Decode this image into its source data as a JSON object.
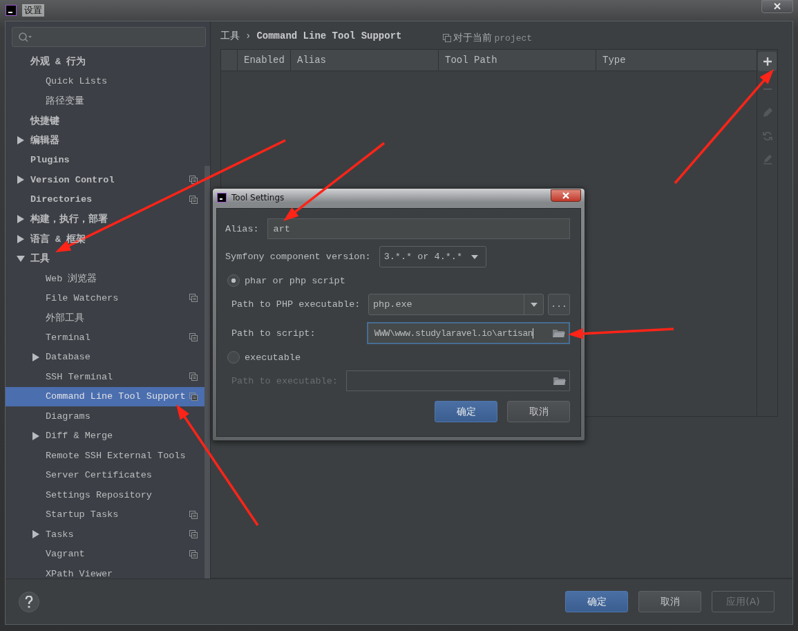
{
  "window": {
    "title": "设置"
  },
  "sidebar": {
    "items": [
      {
        "label": "外观 & 行为",
        "project": false,
        "selected": false,
        "children": [
          {
            "label": "Quick Lists",
            "project": false,
            "selected": false
          },
          {
            "label": "路径变量",
            "project": false,
            "selected": false
          }
        ]
      },
      {
        "label": "快捷键",
        "project": false,
        "selected": false
      },
      {
        "label": "编辑器",
        "expanded": false,
        "project": false,
        "selected": false
      },
      {
        "label": "Plugins",
        "project": false,
        "selected": false
      },
      {
        "label": "Version Control",
        "expanded": false,
        "project": true,
        "selected": false
      },
      {
        "label": "Directories",
        "project": true,
        "selected": false
      },
      {
        "label": "构建，执行，部署",
        "expanded": false,
        "project": false,
        "selected": false
      },
      {
        "label": "语言 & 框架",
        "expanded": false,
        "project": false,
        "selected": false
      },
      {
        "label": "工具",
        "expanded": true,
        "project": false,
        "selected": false,
        "children": [
          {
            "label": "Web 浏览器",
            "project": false,
            "selected": false
          },
          {
            "label": "File Watchers",
            "project": true,
            "selected": false
          },
          {
            "label": "外部工具",
            "project": false,
            "selected": false
          },
          {
            "label": "Terminal",
            "project": true,
            "selected": false
          },
          {
            "label": "Database",
            "expanded": false,
            "project": false,
            "selected": false
          },
          {
            "label": "SSH Terminal",
            "project": true,
            "selected": false
          },
          {
            "label": "Command Line Tool Support",
            "project": true,
            "selected": true
          },
          {
            "label": "Diagrams",
            "project": false,
            "selected": false
          },
          {
            "label": "Diff & Merge",
            "expanded": false,
            "project": false,
            "selected": false
          },
          {
            "label": "Remote SSH External Tools",
            "project": false,
            "selected": false
          },
          {
            "label": "Server Certificates",
            "project": false,
            "selected": false
          },
          {
            "label": "Settings Repository",
            "project": false,
            "selected": false
          },
          {
            "label": "Startup Tasks",
            "project": true,
            "selected": false
          },
          {
            "label": "Tasks",
            "expanded": false,
            "project": true,
            "selected": false
          },
          {
            "label": "Vagrant",
            "project": true,
            "selected": false
          },
          {
            "label": "XPath Viewer",
            "project": false,
            "selected": false
          }
        ]
      }
    ]
  },
  "breadcrumb": {
    "section": "工具",
    "separator": "›",
    "page": "Command Line Tool Support"
  },
  "scope": {
    "label": "对于当前",
    "suffix": "project"
  },
  "table": {
    "columns": [
      "Enabled",
      "Alias",
      "Tool Path",
      "Type"
    ]
  },
  "toolbar": [
    {
      "kind": "add",
      "disabled": false
    },
    {
      "kind": "remove",
      "disabled": true
    },
    {
      "kind": "edit",
      "disabled": true
    },
    {
      "kind": "reload",
      "disabled": true
    },
    {
      "kind": "rename",
      "disabled": true
    }
  ],
  "dialog": {
    "title": "Tool Settings",
    "alias": {
      "label": "Alias:",
      "value": "art"
    },
    "version": {
      "label": "Symfony component version:",
      "value": "3.*.* or 4.*.*"
    },
    "options": [
      {
        "label": "phar or php script",
        "selected": true
      },
      {
        "label": "executable",
        "selected": false
      }
    ],
    "php_executable": {
      "label": "Path to PHP executable:",
      "value": "php.exe",
      "more": "..."
    },
    "script": {
      "label": "Path to script:",
      "value": "WWW\\www.studylaravel.io\\artisan",
      "focused": true
    },
    "executable_path": {
      "label": "Path to executable:",
      "disabled": true
    },
    "buttons": [
      {
        "label": "确定",
        "kind": "primary",
        "disabled": false
      },
      {
        "label": "取消",
        "kind": "normal",
        "disabled": false
      }
    ]
  },
  "buttons": [
    {
      "label": "确定",
      "kind": "primary",
      "disabled": false
    },
    {
      "label": "取消",
      "kind": "normal",
      "disabled": false
    },
    {
      "label": "应用(A)",
      "kind": "normal",
      "disabled": true
    }
  ]
}
